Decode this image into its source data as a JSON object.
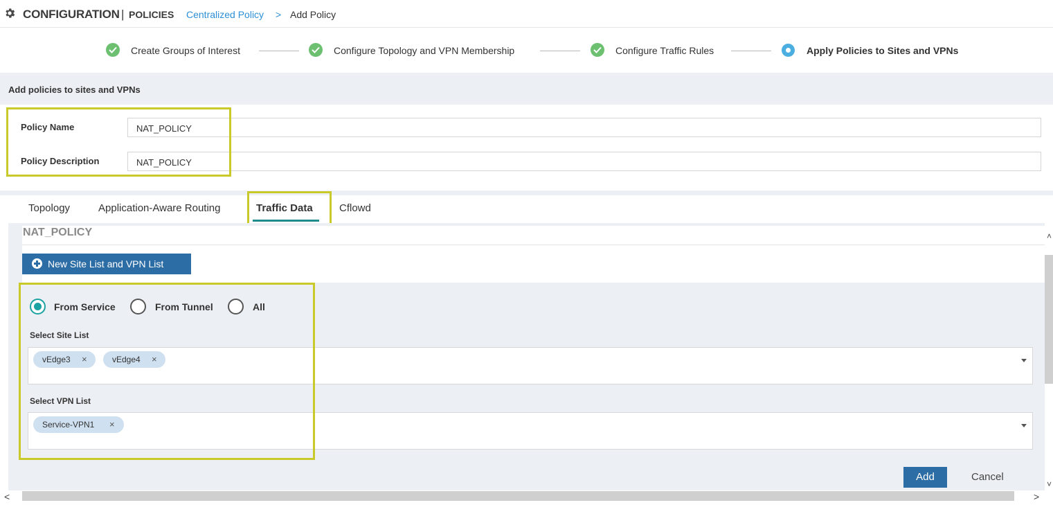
{
  "header": {
    "section": "CONFIGURATION",
    "separator": "|",
    "subsection": "POLICIES",
    "breadcrumb_link": "Centralized Policy",
    "breadcrumb_sep": ">",
    "breadcrumb_current": "Add Policy"
  },
  "wizard": {
    "steps": [
      {
        "label": "Create Groups of Interest",
        "status": "complete"
      },
      {
        "label": "Configure Topology and VPN Membership",
        "status": "complete"
      },
      {
        "label": "Configure Traffic Rules",
        "status": "complete"
      },
      {
        "label": "Apply Policies to Sites and VPNs",
        "status": "active"
      }
    ]
  },
  "section_title": "Add policies to sites and VPNs",
  "form": {
    "policy_name_label": "Policy Name",
    "policy_name_value": "NAT_POLICY",
    "policy_description_label": "Policy Description",
    "policy_description_value": "NAT_POLICY"
  },
  "tabs": [
    {
      "label": "Topology",
      "active": false
    },
    {
      "label": "Application-Aware Routing",
      "active": false
    },
    {
      "label": "Traffic Data",
      "active": true
    },
    {
      "label": "Cflowd",
      "active": false
    }
  ],
  "panel": {
    "policy_name": "NAT_POLICY",
    "new_list_button": "New Site List and VPN List",
    "direction_options": [
      {
        "label": "From Service",
        "selected": true
      },
      {
        "label": "From Tunnel",
        "selected": false
      },
      {
        "label": "All",
        "selected": false
      }
    ],
    "site_list_label": "Select Site List",
    "site_list_chips": [
      "vEdge3",
      "vEdge4"
    ],
    "vpn_list_label": "Select VPN List",
    "vpn_list_chips": [
      "Service-VPN1"
    ],
    "chip_remove": "×",
    "add_button": "Add",
    "cancel_button": "Cancel"
  },
  "scroll": {
    "up": "˄",
    "down": "˅",
    "left": "<",
    "right": ">"
  },
  "colors": {
    "accent_blue": "#2d6da6",
    "link_blue": "#2c8fd6",
    "complete_green": "#6cc070",
    "active_step": "#4aaee0",
    "tab_underline": "#1f8b8b",
    "highlight": "#c9c92a",
    "radio_selected": "#1ba2a2"
  }
}
